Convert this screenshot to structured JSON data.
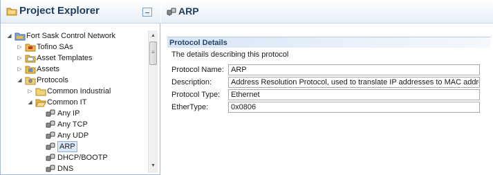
{
  "explorer": {
    "title": "Project Explorer",
    "minimize_icon": "minimize-icon",
    "tree": [
      {
        "label": "Fort Sask Control Network",
        "depth": 0,
        "toggle": "expanded",
        "icon": "network-folder-icon"
      },
      {
        "label": "Tofino SAs",
        "depth": 1,
        "toggle": "collapsed",
        "icon": "sa-folder-icon"
      },
      {
        "label": "Asset Templates",
        "depth": 1,
        "toggle": "collapsed",
        "icon": "templates-folder-icon"
      },
      {
        "label": "Assets",
        "depth": 1,
        "toggle": "collapsed",
        "icon": "assets-folder-icon"
      },
      {
        "label": "Protocols",
        "depth": 1,
        "toggle": "expanded",
        "icon": "protocols-folder-icon"
      },
      {
        "label": "Common Industrial",
        "depth": 2,
        "toggle": "collapsed",
        "icon": "folder-icon"
      },
      {
        "label": "Common IT",
        "depth": 2,
        "toggle": "expanded",
        "icon": "open-folder-icon"
      },
      {
        "label": "Any IP",
        "depth": 3,
        "toggle": "none",
        "icon": "protocol-icon"
      },
      {
        "label": "Any TCP",
        "depth": 3,
        "toggle": "none",
        "icon": "protocol-icon"
      },
      {
        "label": "Any UDP",
        "depth": 3,
        "toggle": "none",
        "icon": "protocol-icon"
      },
      {
        "label": "ARP",
        "depth": 3,
        "toggle": "none",
        "icon": "protocol-icon",
        "selected": true
      },
      {
        "label": "DHCP/BOOTP",
        "depth": 3,
        "toggle": "none",
        "icon": "protocol-icon"
      },
      {
        "label": "DNS",
        "depth": 3,
        "toggle": "none",
        "icon": "protocol-icon"
      }
    ]
  },
  "editor": {
    "title": "ARP",
    "icon": "protocol-icon",
    "section": {
      "title": "Protocol Details",
      "description": "The details describing this protocol",
      "fields": [
        {
          "label": "Protocol Name:",
          "value": "ARP"
        },
        {
          "label": "Description:",
          "value": "Address Resolution Protocol, used to translate IP addresses to MAC addresses"
        },
        {
          "label": "Protocol Type:",
          "value": "Ethernet"
        },
        {
          "label": "EtherType:",
          "value": "0x0806"
        }
      ]
    }
  },
  "colors": {
    "header_title": "#1f3a5f",
    "section_title": "#23466e",
    "selection_bg": "#dbe8f7",
    "folder": "#e8b84a"
  }
}
